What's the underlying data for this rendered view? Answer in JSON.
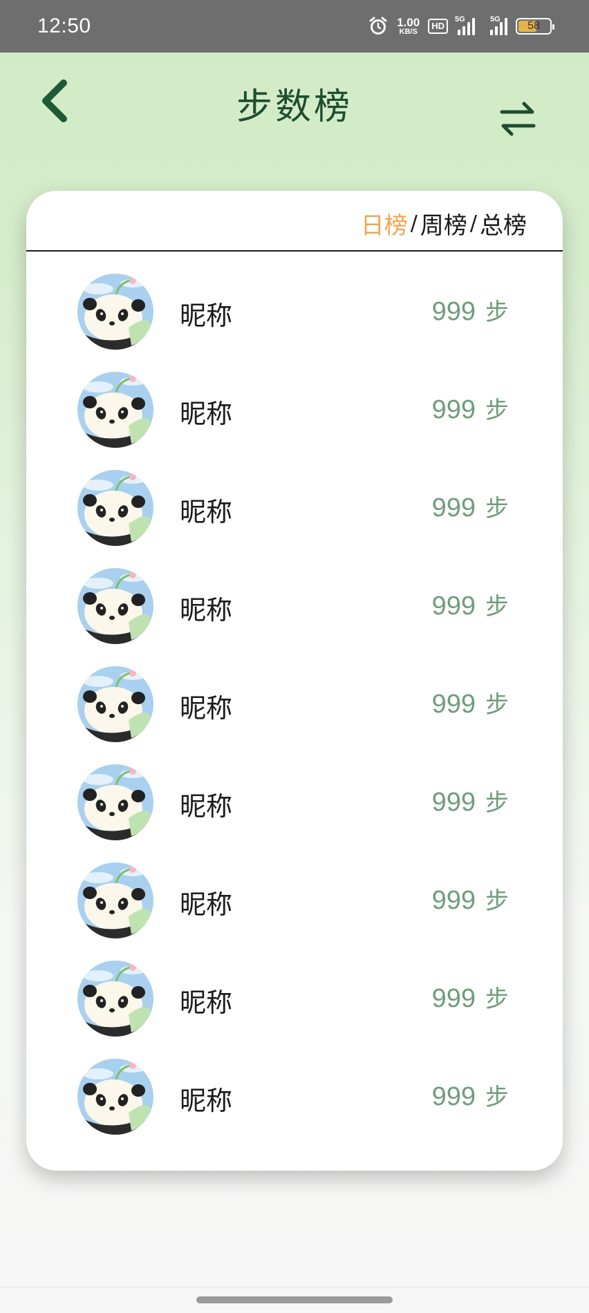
{
  "status_bar": {
    "time": "12:50",
    "net_speed_value": "1.00",
    "net_speed_unit": "KB/S",
    "hd_label": "HD",
    "signal1_label": "5G",
    "signal2_label": "5G",
    "battery_level": "58",
    "battery_percent": 58,
    "icons": [
      "alarm-icon",
      "hd-icon",
      "signal-icon",
      "signal-icon",
      "battery-icon"
    ]
  },
  "header": {
    "title": "步数榜",
    "back_icon": "chevron-left-icon",
    "switch_icon": "swap-arrows-icon"
  },
  "tabs": [
    {
      "label": "日榜",
      "active": true
    },
    {
      "label": "周榜",
      "active": false
    },
    {
      "label": "总榜",
      "active": false
    }
  ],
  "tab_separator": "/",
  "ranking": [
    {
      "nickname": "昵称",
      "steps": "999",
      "unit": "步"
    },
    {
      "nickname": "昵称",
      "steps": "999",
      "unit": "步"
    },
    {
      "nickname": "昵称",
      "steps": "999",
      "unit": "步"
    },
    {
      "nickname": "昵称",
      "steps": "999",
      "unit": "步"
    },
    {
      "nickname": "昵称",
      "steps": "999",
      "unit": "步"
    },
    {
      "nickname": "昵称",
      "steps": "999",
      "unit": "步"
    },
    {
      "nickname": "昵称",
      "steps": "999",
      "unit": "步"
    },
    {
      "nickname": "昵称",
      "steps": "999",
      "unit": "步"
    },
    {
      "nickname": "昵称",
      "steps": "999",
      "unit": "步"
    }
  ],
  "colors": {
    "title": "#1e4d2f",
    "active_tab": "#f0a552",
    "steps": "#6f9c7d",
    "background_top": "#d2ebc6"
  }
}
